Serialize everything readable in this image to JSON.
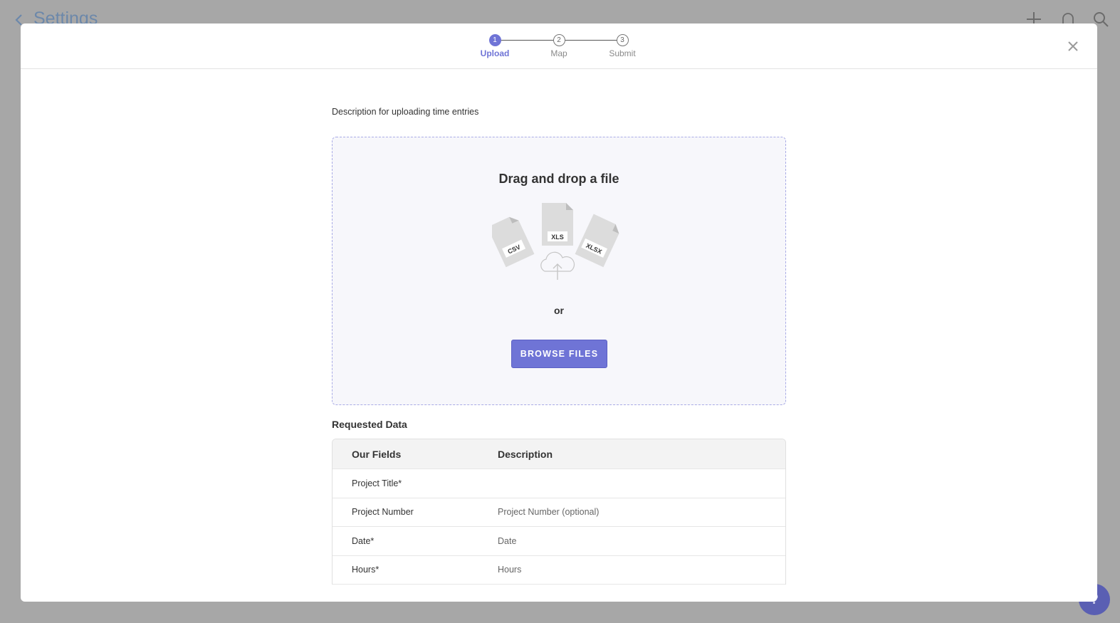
{
  "background": {
    "title": "Settings",
    "icons": [
      "back-arrow-icon",
      "plus-icon",
      "bell-icon",
      "search-icon",
      "help-icon"
    ],
    "help_glyph": "?"
  },
  "stepper": {
    "steps": [
      {
        "number": "1",
        "label": "Upload",
        "active": true
      },
      {
        "number": "2",
        "label": "Map",
        "active": false
      },
      {
        "number": "3",
        "label": "Submit",
        "active": false
      }
    ]
  },
  "upload": {
    "description": "Description for uploading time entries",
    "dropzone_title": "Drag and drop a file",
    "file_types": [
      "CSV",
      "XLS",
      "XLSX"
    ],
    "or_text": "or",
    "browse_label": "BROWSE FILES"
  },
  "requested": {
    "title": "Requested Data",
    "columns": [
      "Our Fields",
      "Description"
    ],
    "rows": [
      {
        "field": "Project Title*",
        "description": ""
      },
      {
        "field": "Project Number",
        "description": "Project Number (optional)"
      },
      {
        "field": "Date*",
        "description": "Date"
      },
      {
        "field": "Hours*",
        "description": "Hours"
      }
    ]
  },
  "colors": {
    "accent": "#6f74d6",
    "overlay": "#a7a7a7"
  }
}
